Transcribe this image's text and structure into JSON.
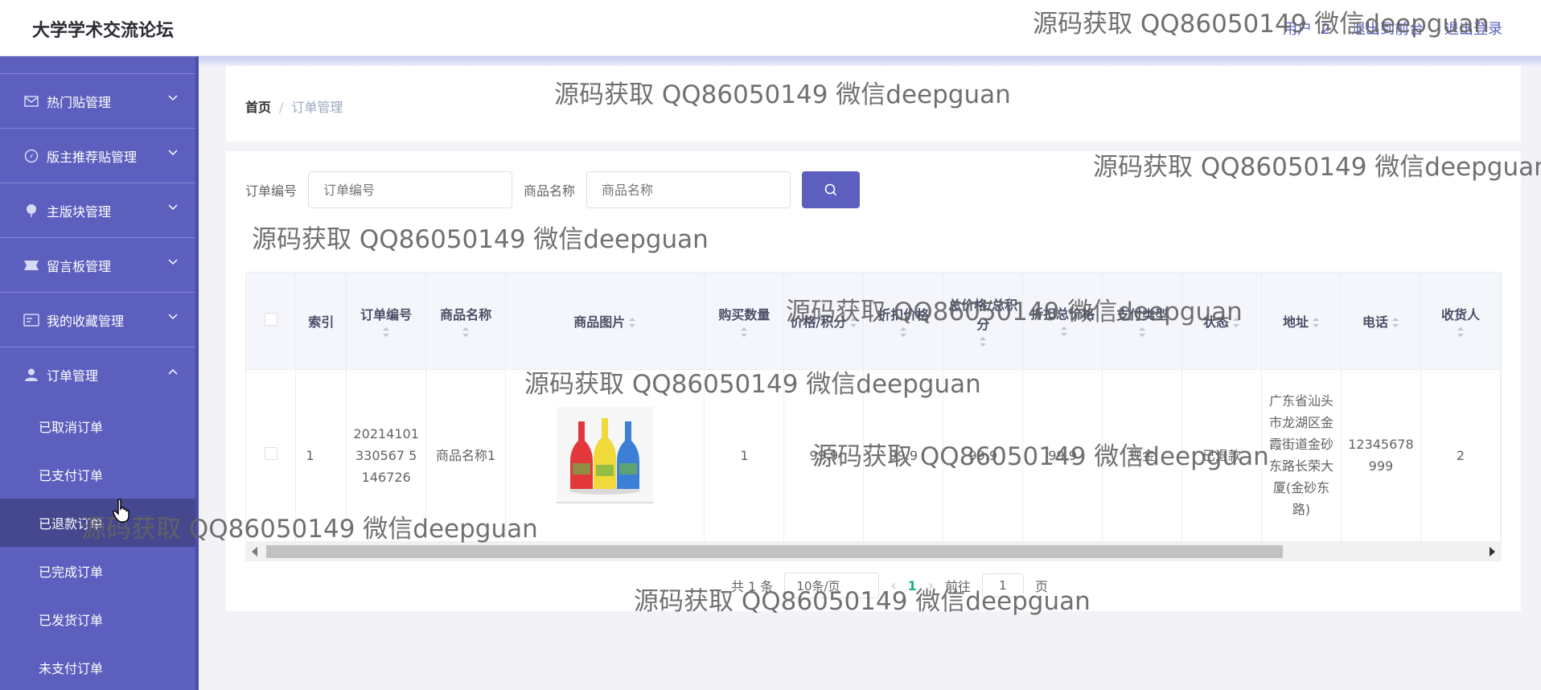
{
  "header": {
    "brand": "大学学术交流论坛",
    "user": "用户",
    "user_suffix": "2",
    "exit_to_front": "退出到前台",
    "logout": "退出登录"
  },
  "sidebar": {
    "items": [
      {
        "label": "热门贴管理",
        "icon": "mail-icon"
      },
      {
        "label": "版主推荐贴管理",
        "icon": "compass-icon"
      },
      {
        "label": "主版块管理",
        "icon": "pin-icon"
      },
      {
        "label": "留言板管理",
        "icon": "ticket-icon"
      },
      {
        "label": "我的收藏管理",
        "icon": "card-icon"
      },
      {
        "label": "订单管理",
        "icon": "user-icon"
      }
    ],
    "sub_items": [
      "已取消订单",
      "已支付订单",
      "已退款订单",
      "已完成订单",
      "已发货订单",
      "未支付订单"
    ],
    "active_sub": "已退款订单"
  },
  "breadcrumb": {
    "home": "首页",
    "separator": "/",
    "current": "订单管理"
  },
  "search": {
    "order_no_label": "订单编号",
    "order_no_placeholder": "订单编号",
    "product_label": "商品名称",
    "product_placeholder": "商品名称"
  },
  "table": {
    "columns": [
      "索引",
      "订单编号",
      "商品名称",
      "商品图片",
      "购买数量",
      "价格/积分",
      "折扣价格",
      "总价格/总积分",
      "折扣总价格",
      "支付类型",
      "状态",
      "地址",
      "电话",
      "收货人"
    ],
    "rows": [
      {
        "index": "1",
        "order_no": "20214101330567 5146726",
        "product_name": "商品名称1",
        "quantity": "1",
        "price": "99.9",
        "discount_price": "99.9",
        "total": "99.9",
        "discount_total": "99.9",
        "pay_type": "现金",
        "status": "已退款",
        "address": "广东省汕头市龙湖区金霞街道金砂东路长荣大厦(金砂东路)",
        "phone": "12345678999",
        "receiver": "2"
      }
    ]
  },
  "pagination": {
    "total": "共 1 条",
    "page_size": "10条/页",
    "current_page": "1",
    "goto_label": "前往",
    "goto_value": "1",
    "page_unit": "页"
  },
  "watermark": "源码获取 QQ86050149 微信deepguan",
  "colors": {
    "sidebar": "#5c5fbd",
    "accent": "#5c5fbd",
    "active_sub": "#45478f"
  }
}
